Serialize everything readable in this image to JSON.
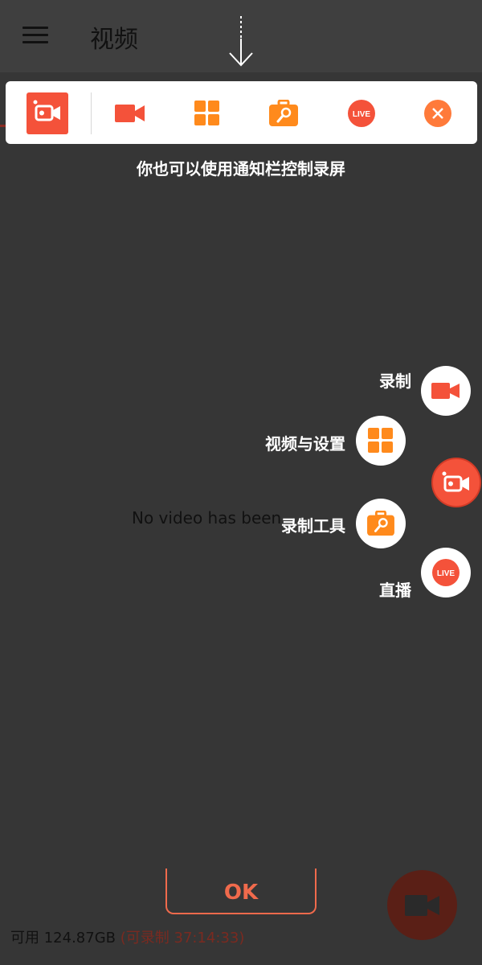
{
  "app_bar": {
    "title": "视频",
    "menu_icon": "hamburger-icon"
  },
  "notification_bar": {
    "items": [
      {
        "name": "app-logo",
        "icon": "screen-recorder-logo-icon"
      },
      {
        "name": "record",
        "icon": "video-camera-icon"
      },
      {
        "name": "videos-settings",
        "icon": "grid-icon"
      },
      {
        "name": "tools",
        "icon": "toolbox-icon"
      },
      {
        "name": "live",
        "icon": "live-icon",
        "text": "LIVE"
      },
      {
        "name": "close",
        "icon": "close-icon"
      }
    ]
  },
  "hint": "你也可以使用通知栏控制录屏",
  "empty_message": "No video has been",
  "fab_menu": {
    "items": [
      {
        "label": "录制",
        "icon": "video-camera-icon"
      },
      {
        "label": "视频与设置",
        "icon": "grid-icon"
      },
      {
        "label": "录制工具",
        "icon": "toolbox-icon"
      },
      {
        "label": "直播",
        "icon": "live-icon",
        "badge": "LIVE"
      }
    ],
    "main_icon": "screen-recorder-logo-icon"
  },
  "ok_button": "OK",
  "storage": {
    "available": "可用 124.87GB",
    "recordable": "(可录制 37:14:33)"
  },
  "colors": {
    "accent": "#f4523a",
    "orange": "#ff8a1c",
    "overlay_bg": "#363636"
  }
}
